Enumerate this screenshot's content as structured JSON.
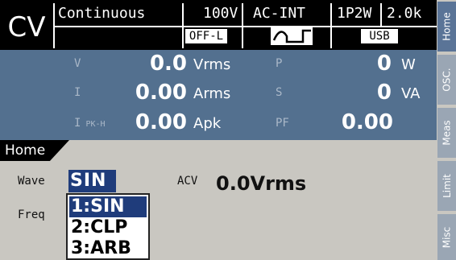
{
  "status": {
    "mode": "CV",
    "output_mode": "Continuous",
    "range": "100V",
    "source": "AC-INT",
    "wiring": "1P2W",
    "current_range": "2.0k",
    "limit": "OFF-L",
    "waveform_icon": "sine-square-wave-icon",
    "interface": "USB"
  },
  "measurements": {
    "v_label": "V",
    "v_value": "0.0",
    "v_unit": "Vrms",
    "i_label": "I",
    "i_value": "0.00",
    "i_unit": "Arms",
    "ipk_label": "I",
    "ipk_sub": "PK-H",
    "ipk_value": "0.00",
    "ipk_unit": "Apk",
    "p_label": "P",
    "p_value": "0",
    "p_unit": "W",
    "s_label": "S",
    "s_value": "0",
    "s_unit": "VA",
    "pf_label": "PF",
    "pf_value": "0.00"
  },
  "home": {
    "title": "Home",
    "wave_label": "Wave",
    "wave_value": "SIN",
    "freq_label": "Freq",
    "acv_label": "ACV",
    "acv_value": "0.0Vrms",
    "wave_options": [
      "1:SIN",
      "2:CLP",
      "3:ARB"
    ]
  },
  "softkeys": [
    "Home",
    "OSC.",
    "Meas",
    "Limit",
    "Misc"
  ],
  "colors": {
    "panel": "#53708f",
    "highlight": "#1f3c7b",
    "background": "#c9c7c1"
  }
}
